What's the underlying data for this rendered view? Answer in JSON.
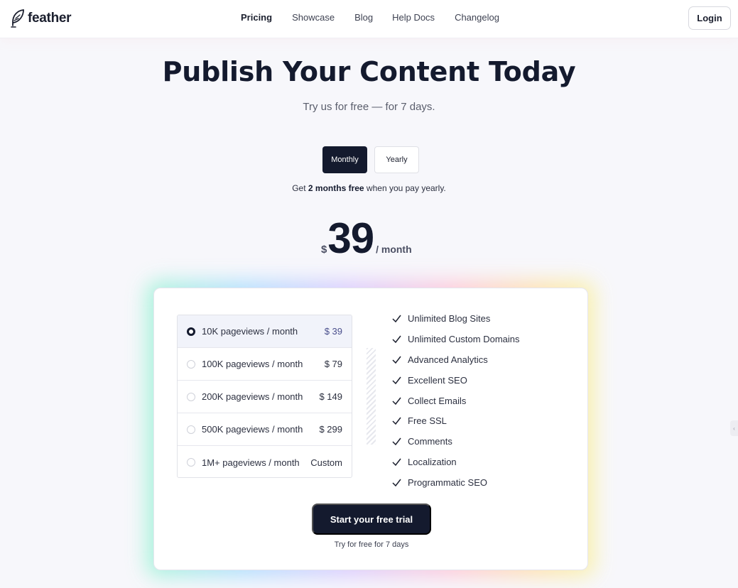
{
  "brand": {
    "name": "feather",
    "logo_icon": "feather-logo-icon"
  },
  "nav": {
    "items": [
      {
        "label": "Pricing",
        "active": true
      },
      {
        "label": "Showcase",
        "active": false
      },
      {
        "label": "Blog",
        "active": false
      },
      {
        "label": "Help Docs",
        "active": false
      },
      {
        "label": "Changelog",
        "active": false
      }
    ],
    "login_label": "Login"
  },
  "hero": {
    "title": "Publish Your Content Today",
    "subtitle": "Try us for free — for 7 days."
  },
  "billing_toggle": {
    "options": [
      "Monthly",
      "Yearly"
    ],
    "selected": "Monthly"
  },
  "promo": {
    "prefix": "Get ",
    "bold": "2 months free",
    "suffix": " when you pay yearly."
  },
  "price": {
    "currency": "$",
    "amount": "39",
    "period": "/ month"
  },
  "plans": [
    {
      "label": "10K pageviews / month",
      "price": "$ 39",
      "selected": true
    },
    {
      "label": "100K pageviews / month",
      "price": "$ 79",
      "selected": false
    },
    {
      "label": "200K pageviews / month",
      "price": "$ 149",
      "selected": false
    },
    {
      "label": "500K pageviews / month",
      "price": "$ 299",
      "selected": false
    },
    {
      "label": "1M+ pageviews / month",
      "price": "Custom",
      "selected": false
    }
  ],
  "features": [
    "Unlimited Blog Sites",
    "Unlimited Custom Domains",
    "Advanced Analytics",
    "Excellent SEO",
    "Collect Emails",
    "Free SSL",
    "Comments",
    "Localization",
    "Programmatic SEO"
  ],
  "cta": {
    "button_label": "Start your free trial",
    "note": "Try for free for 7 days"
  },
  "colors": {
    "primary_dark": "#141a2e",
    "page_background": "#f7f7fb",
    "selected_plan_bg": "#f1f3fa"
  }
}
